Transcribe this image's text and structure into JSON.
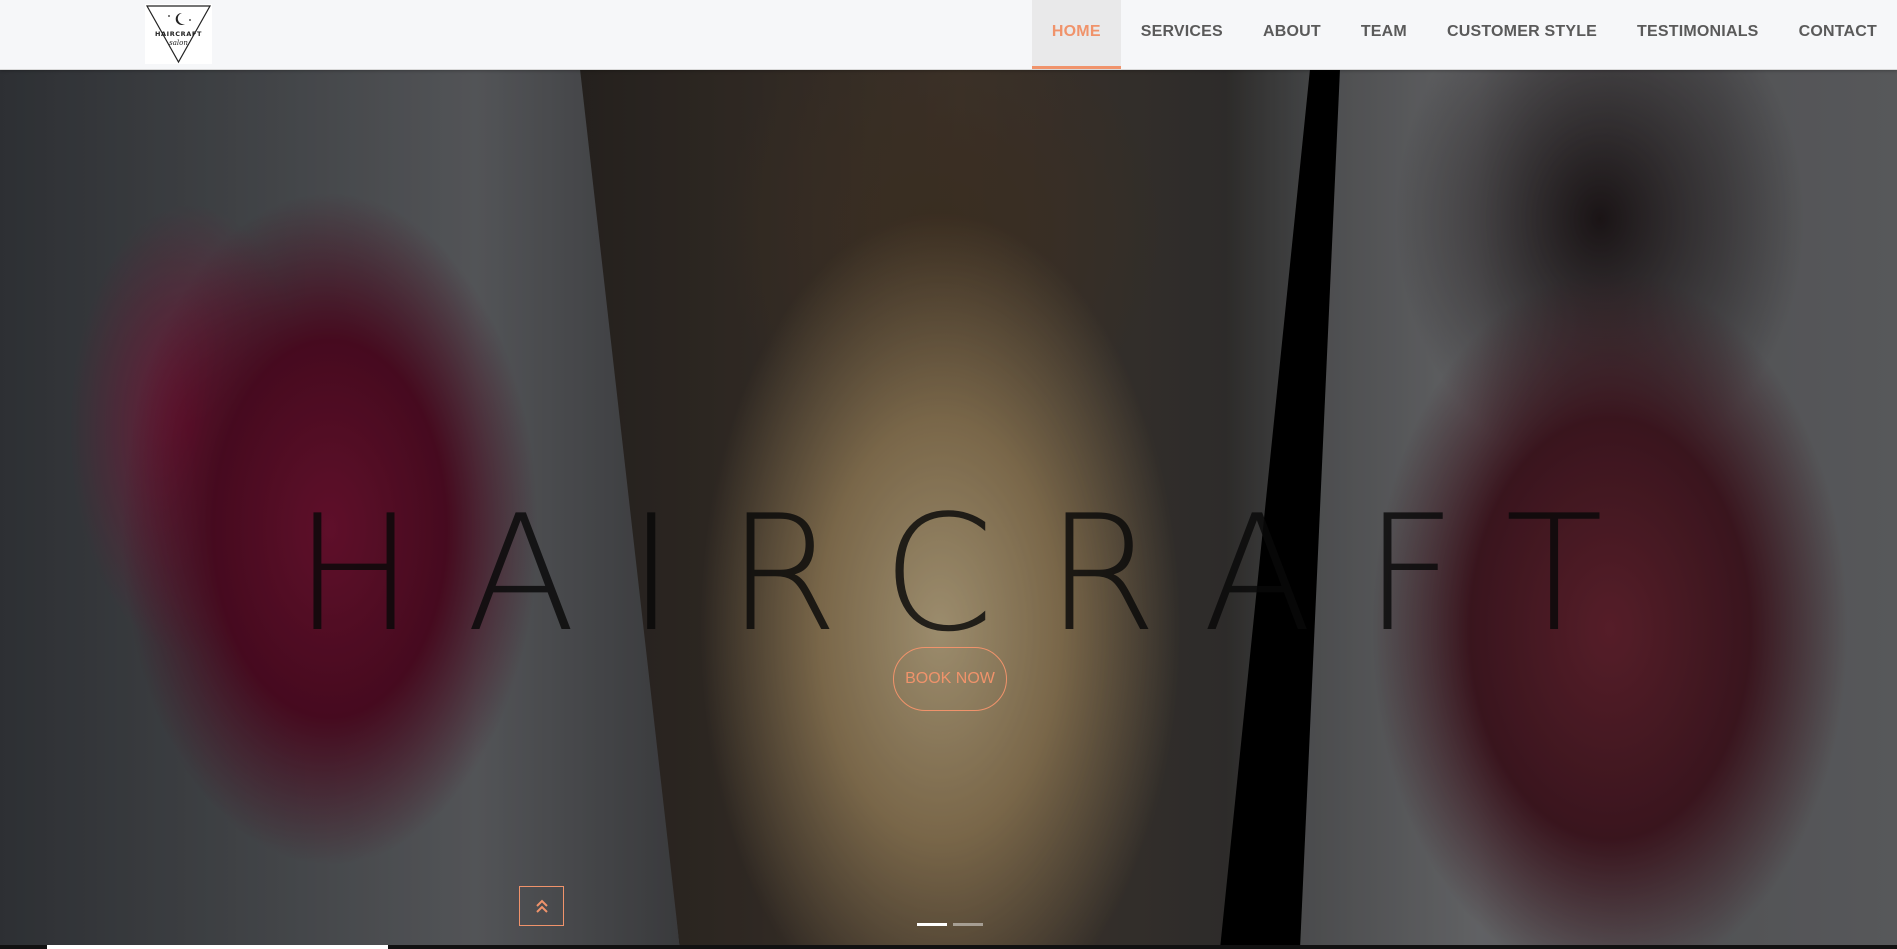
{
  "header": {
    "logo": {
      "alt": "Haircraft Salon",
      "text_top": "HAIRCRAFT",
      "text_bottom": "salon"
    },
    "nav": [
      {
        "label": "HOME",
        "active": true
      },
      {
        "label": "SERVICES",
        "active": false
      },
      {
        "label": "ABOUT",
        "active": false
      },
      {
        "label": "TEAM",
        "active": false
      },
      {
        "label": "CUSTOMER STYLE",
        "active": false
      },
      {
        "label": "TESTIMONIALS",
        "active": false
      },
      {
        "label": "CONTACT",
        "active": false
      }
    ]
  },
  "hero": {
    "title": "HAIRCRAFT",
    "cta_label": "BOOK NOW",
    "scroll_top_icon": "double-chevron-up-icon",
    "slides": {
      "count": 2,
      "active_index": 0
    },
    "progress_fraction": 0.18
  },
  "colors": {
    "accent": "#f0936b",
    "header_bg": "#f6f7f9",
    "nav_text": "#5a5a5a"
  }
}
